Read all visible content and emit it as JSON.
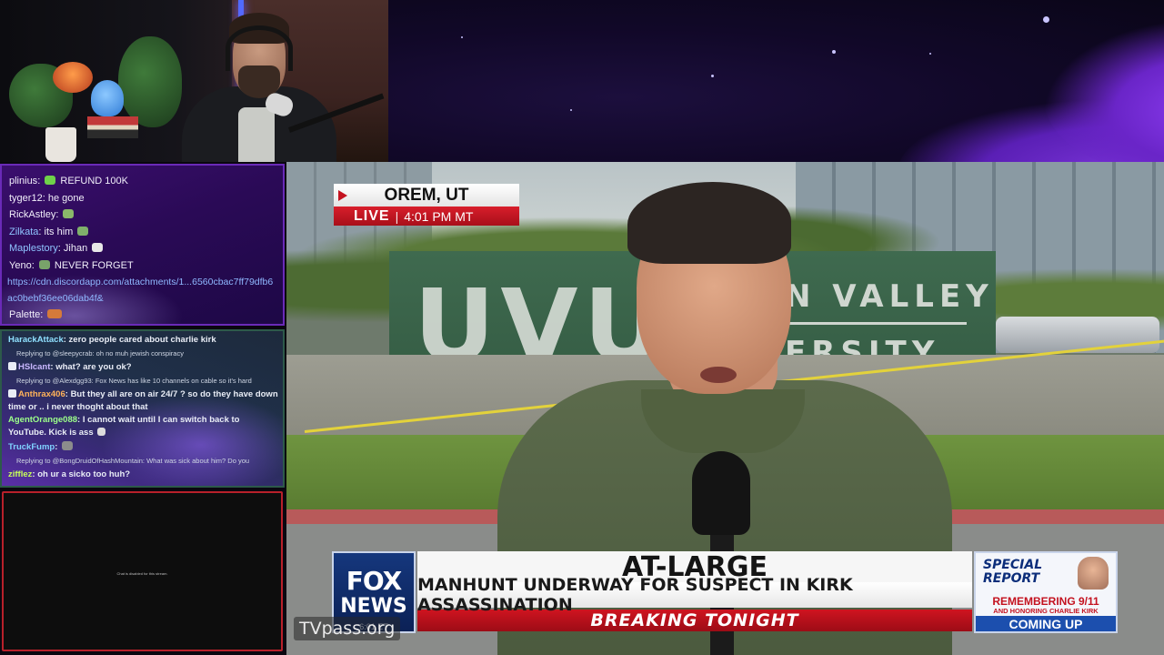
{
  "chat": {
    "top_lines": [
      {
        "user": "plinius",
        "text": "REFUND 100K"
      },
      {
        "user": "tyger12",
        "text": "he gone"
      },
      {
        "user": "RickAstley",
        "text": ""
      },
      {
        "user": "Zilkata",
        "text": "its him"
      },
      {
        "user": "Maplestory",
        "text": "Jihan"
      },
      {
        "user": "Yeno",
        "text": "NEVER FORGET"
      }
    ],
    "link": "https://cdn.discordapp.com/attachments/1...6560cbac7ff79dfb6ac0bebf36ee06dab4f&",
    "palette_user": "Palette",
    "messages": [
      {
        "user": "HarackAttack",
        "user_color": "#8fe0ff",
        "text": "zero people cared about charlie kirk"
      },
      {
        "reply": "Replying to @sleepycrab: oh no muh jewish conspiracy"
      },
      {
        "user": "HSIcant",
        "user_color": "#c9b8ff",
        "text": "what? are you ok?"
      },
      {
        "reply": "Replying to @Alexdgg93: Fox News has like 10 channels on cable so it's hard"
      },
      {
        "user": "Anthrax406",
        "user_color": "#ffb25a",
        "text": "But they all are on air 24/7 ? so do they have down time or .. i never thoght about that"
      },
      {
        "user": "AgentOrange088",
        "user_color": "#9cff8a",
        "text": "I cannot wait until I can switch back to YouTube. Kick is ass"
      },
      {
        "user": "TruckFump",
        "user_color": "#7fd2ff",
        "text": ""
      },
      {
        "reply": "Replying to @BongDruidOfHashMountain: What was sick about him? Do you"
      },
      {
        "user": "zifflez",
        "user_color": "#c7ff5a",
        "text": "oh ur a sicko too huh?"
      }
    ],
    "disabled_note": "Chat is disabled for this stream."
  },
  "news": {
    "location": "OREM, UT",
    "live_label": "LIVE",
    "live_sep": "|",
    "live_time": "4:01 PM MT",
    "sign_left": "UVU",
    "sign_line1": "N VALLEY",
    "sign_line2": "ERSITY",
    "logo_top": "FOX",
    "logo_bottom": "NEWS",
    "logo_time": "6:01 ET",
    "headline": "AT-LARGE",
    "subheadline": "MANHUNT UNDERWAY FOR SUSPECT IN KIRK ASSASSINATION",
    "banner": "BREAKING TONIGHT",
    "special_title": "SPECIAL REPORT",
    "special_line1": "REMEMBERING 9/11",
    "special_line2": "AND HONORING CHARLIE KIRK",
    "special_line3": "COMING UP",
    "watermark": "TVpass.org"
  },
  "colors": {
    "accent": "#6a2ab8",
    "fox_red": "#c4121f",
    "fox_blue": "#15377d"
  }
}
